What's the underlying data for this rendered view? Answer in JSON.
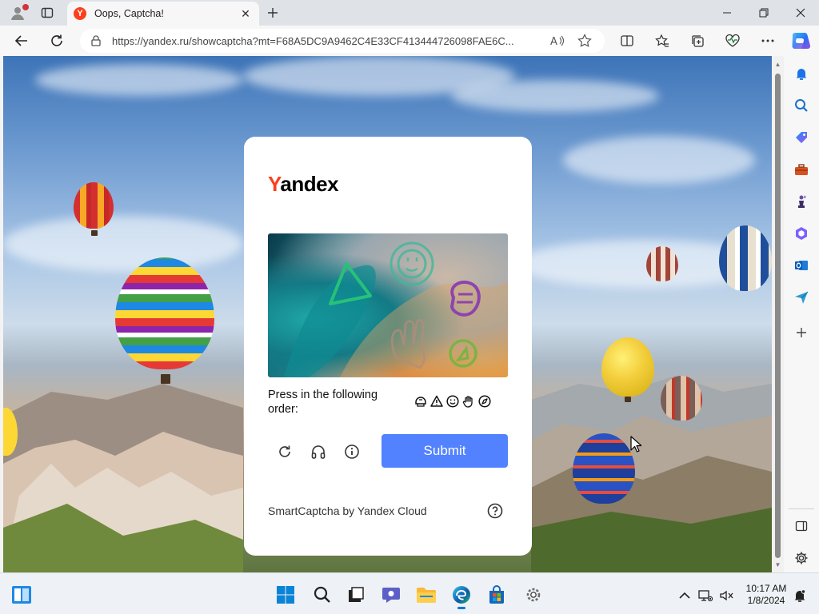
{
  "browser": {
    "tab": {
      "title": "Oops, Captcha!",
      "favicon_letter": "Y"
    },
    "url": "https://yandex.ru/showcaptcha?mt=F68A5DC9A9462C4E33CF413444726098FAE6C...",
    "colors": {
      "accent": "#0078d4",
      "tab_bg": "#f7f7f7",
      "frame_bg": "#dfe3e8"
    }
  },
  "captcha": {
    "logo_first_letter": "Y",
    "logo_rest": "andex",
    "instruction": "Press in the following order:",
    "order_icons": [
      "helmet-icon",
      "warning-triangle-icon",
      "smiley-icon",
      "hand-icon",
      "compass-icon"
    ],
    "submit_label": "Submit",
    "footer": "SmartCaptcha by Yandex Cloud",
    "colors": {
      "brand_red": "#fc3f1d",
      "submit_bg": "#5282ff"
    }
  },
  "taskbar": {
    "time": "10:17 AM",
    "date": "1/8/2024"
  }
}
